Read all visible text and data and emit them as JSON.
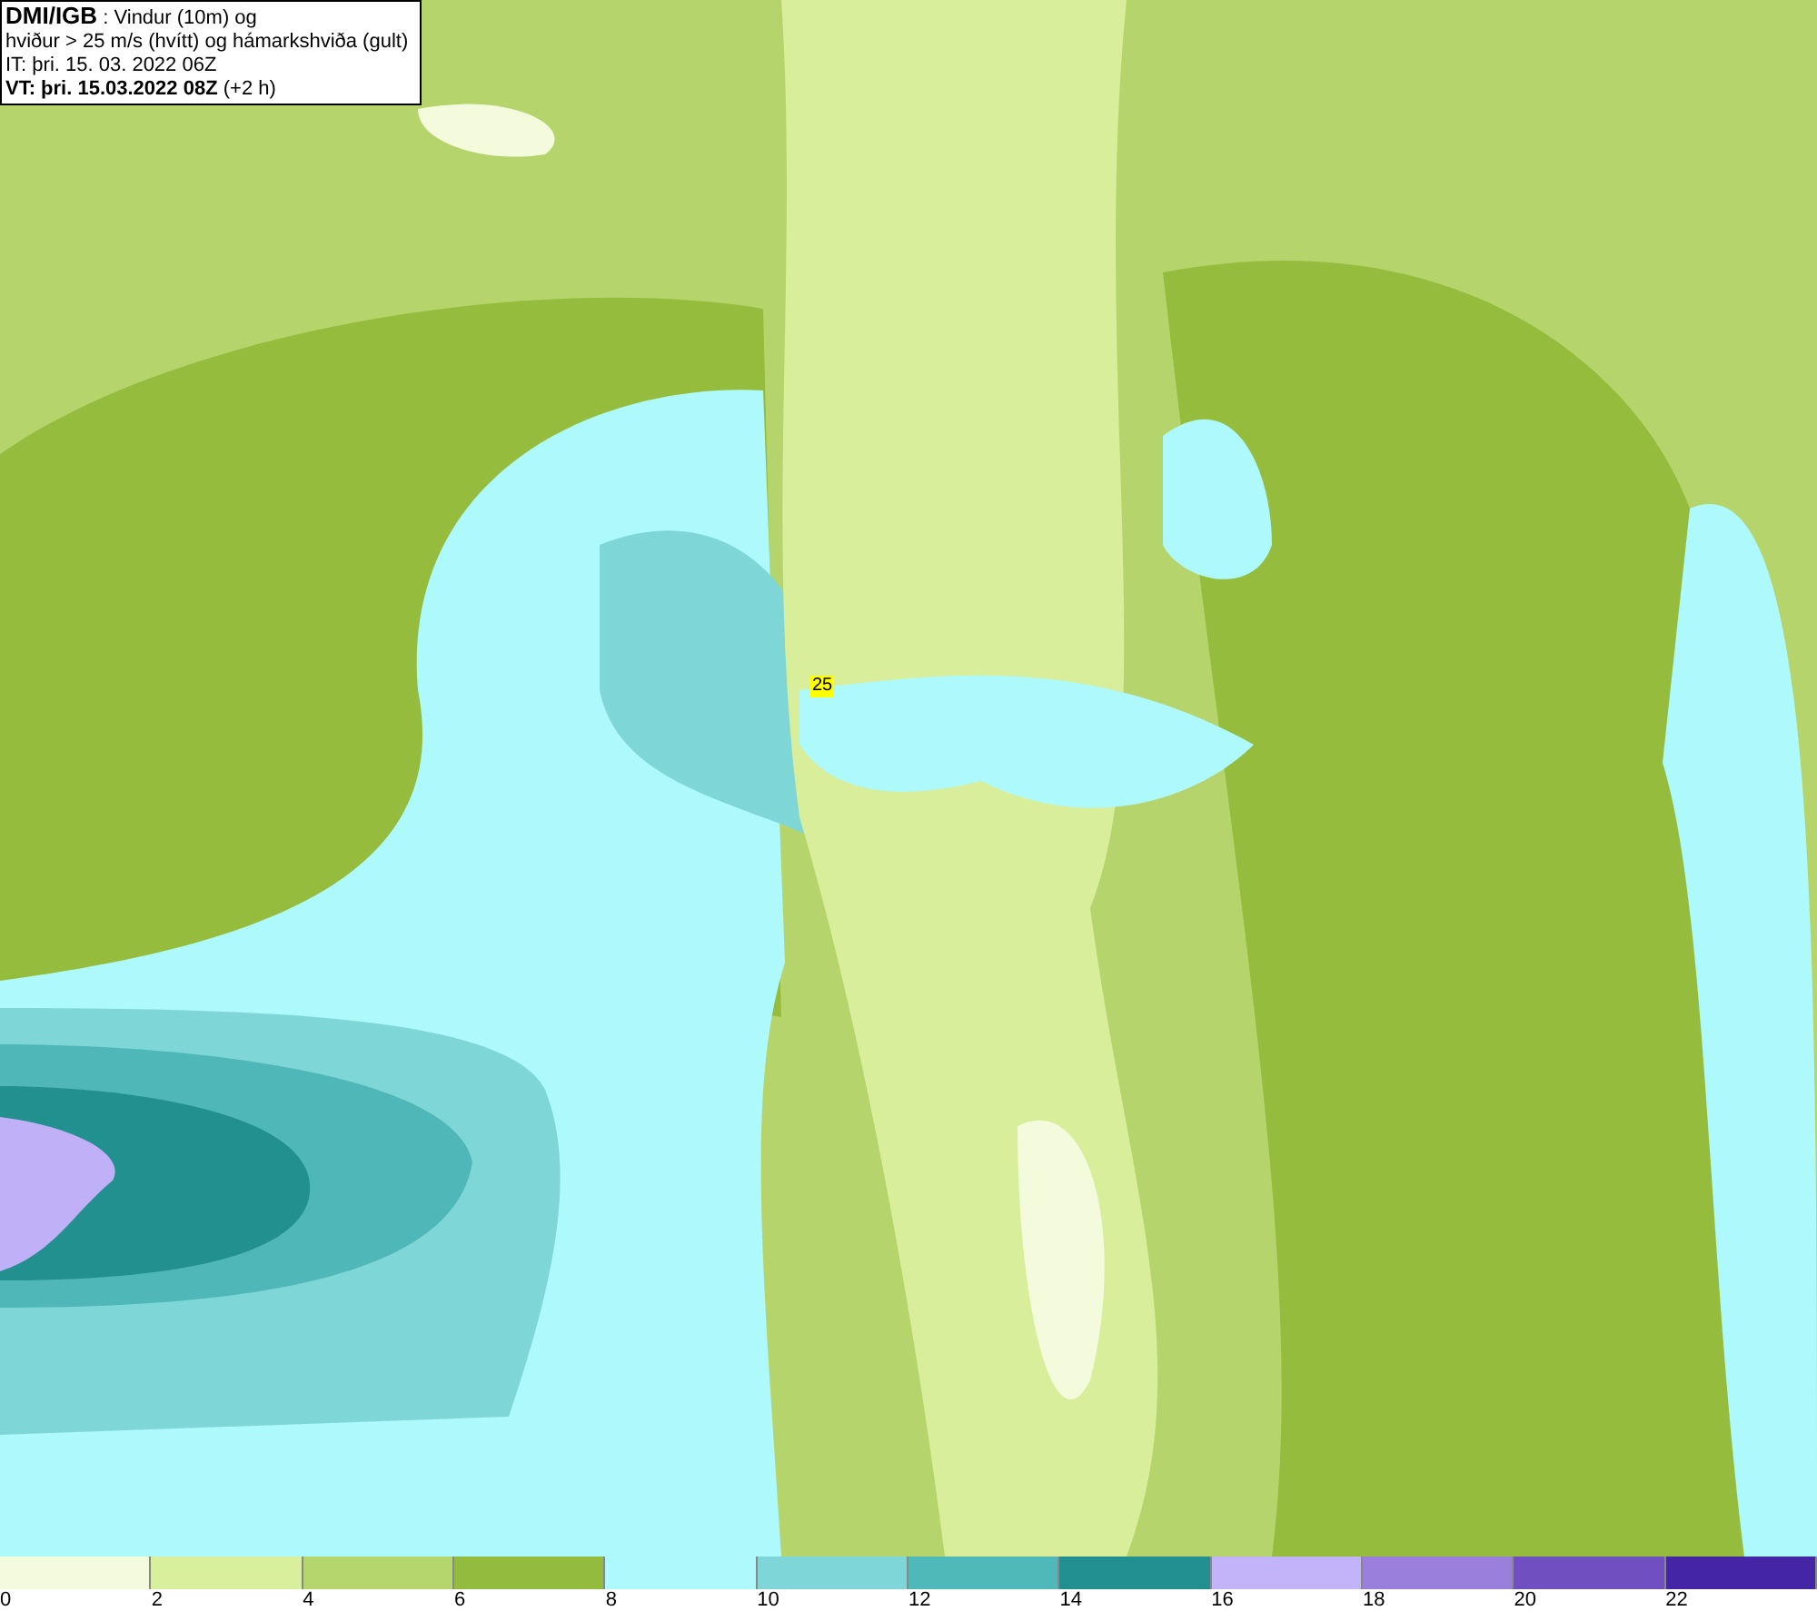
{
  "info_box": {
    "lines": [
      "**DMI/IGB** : Vindur (10m) og",
      "hviður > 25 m/s (hvítt) og hámarkshviða (gult)",
      "IT: þri. 15. 03. 2022 06Z",
      "**VT: þri. 15.03.2022 08Z** (+2 h)"
    ]
  },
  "map": {
    "gust_marker": "25"
  },
  "legend": {
    "bins": [
      {
        "label": "0",
        "color": "#f4fbdc"
      },
      {
        "label": "2",
        "color": "#d8f09c"
      },
      {
        "label": "4",
        "color": "#b5d66c"
      },
      {
        "label": "6",
        "color": "#93bb3d"
      },
      {
        "label": "8",
        "color": "#aef9fb"
      },
      {
        "label": "10",
        "color": "#7fd6d8"
      },
      {
        "label": "12",
        "color": "#4fb8b8"
      },
      {
        "label": "14",
        "color": "#229090"
      },
      {
        "label": "16",
        "color": "#c3b3f8"
      },
      {
        "label": "18",
        "color": "#9a80dc"
      },
      {
        "label": "20",
        "color": "#7050c0"
      },
      {
        "label": "22",
        "color": "#4426a4"
      }
    ]
  }
}
